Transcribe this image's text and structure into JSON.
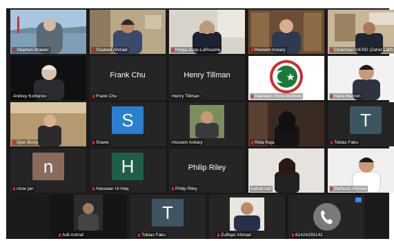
{
  "participants": [
    {
      "name": "Stephen Brawer",
      "kind": "video",
      "scene": "bridge",
      "muted": true
    },
    {
      "name": "Shakeel Ahmad",
      "kind": "video",
      "scene": "office",
      "muted": true
    },
    {
      "name": "Helga Zepp-LaRouche",
      "kind": "video",
      "scene": "room",
      "muted": true
    },
    {
      "name": "Hussein Askary",
      "kind": "video",
      "scene": "bookshelf",
      "muted": true
    },
    {
      "name": "Chairman AIERD (Zahid Latif)",
      "kind": "video",
      "scene": "study",
      "muted": true
    },
    {
      "name": "Andrey Kortunov",
      "kind": "video",
      "scene": "dark",
      "muted": false,
      "active": true
    },
    {
      "name": "Frank Chu",
      "kind": "name",
      "muted": true
    },
    {
      "name": "Henry Tillman",
      "kind": "name",
      "muted": false
    },
    {
      "name": "Pakistan China Institute",
      "kind": "logo",
      "muted": true
    },
    {
      "name": "Haris Memon",
      "kind": "video",
      "scene": "white",
      "muted": true
    },
    {
      "name": "Gjon Boriçi",
      "kind": "video",
      "scene": "speaker",
      "muted": true
    },
    {
      "name": "Shane",
      "kind": "avatar",
      "letter": "S",
      "color": "#2a7fd0",
      "muted": true
    },
    {
      "name": "Hussein Askary",
      "kind": "video",
      "scene": "portrait",
      "muted": false
    },
    {
      "name": "Rida Raja",
      "kind": "video",
      "scene": "woman",
      "muted": true
    },
    {
      "name": "Tobias Faku",
      "kind": "avatar",
      "letter": "T",
      "color": "#3c5560",
      "muted": true
    },
    {
      "name": "nizar jan",
      "kind": "avatar",
      "letter": "n",
      "color": "#8a6a5a",
      "muted": true
    },
    {
      "name": "Hassaan Ul Haq",
      "kind": "avatar",
      "letter": "H",
      "color": "#1f5e4a",
      "muted": true
    },
    {
      "name": "Philip Riley",
      "kind": "name",
      "muted": true
    },
    {
      "name": "kainat saif",
      "kind": "video",
      "scene": "woman2",
      "muted": false
    },
    {
      "name": "Sarfaraz Ahmed",
      "kind": "video",
      "scene": "man_white",
      "muted": true
    },
    {
      "name": "Adil Ashraf",
      "kind": "video",
      "scene": "dark_man",
      "muted": true
    },
    {
      "name": "Tobias Faku",
      "kind": "avatar",
      "letter": "T",
      "color": "#3c5560",
      "muted": true
    },
    {
      "name": "Zulfiqar Ahmad",
      "kind": "video",
      "scene": "suit",
      "muted": true
    },
    {
      "name": "61424255142",
      "kind": "phone",
      "muted": true
    }
  ],
  "bigname_labels": {
    "frank": "Frank Chu",
    "henry": "Henry Tillman",
    "philip": "Philip Riley"
  },
  "colors": {
    "mute": "#e22222",
    "active_border": "#c8e6a0",
    "tile_bg": "#252525"
  }
}
